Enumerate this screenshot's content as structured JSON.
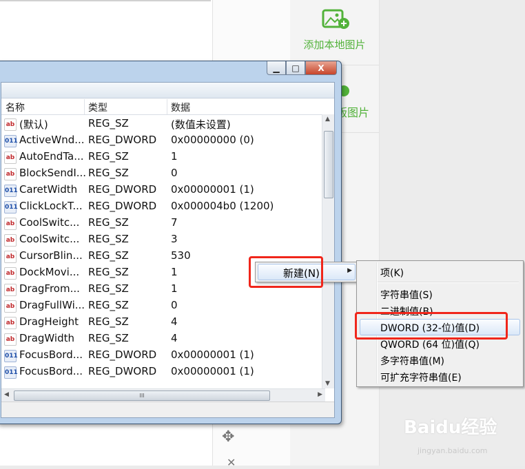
{
  "panel": {
    "add_local_image": "添加本地图片",
    "partial_label": "版图片",
    "watermark": "Baidu经验",
    "watermark_url": "jingyan.baidu.com"
  },
  "window": {
    "min": "▁",
    "max": "□",
    "close": "X"
  },
  "columns": {
    "name": "名称",
    "type": "类型",
    "data": "数据"
  },
  "rows": [
    {
      "icon": "ab",
      "name": "(默认)",
      "type": "REG_SZ",
      "data": "(数值未设置)"
    },
    {
      "icon": "dw",
      "name": "ActiveWnd...",
      "type": "REG_DWORD",
      "data": "0x00000000 (0)"
    },
    {
      "icon": "ab",
      "name": "AutoEndTa...",
      "type": "REG_SZ",
      "data": "1"
    },
    {
      "icon": "ab",
      "name": "BlockSendI...",
      "type": "REG_SZ",
      "data": "0"
    },
    {
      "icon": "dw",
      "name": "CaretWidth",
      "type": "REG_DWORD",
      "data": "0x00000001 (1)"
    },
    {
      "icon": "dw",
      "name": "ClickLockT...",
      "type": "REG_DWORD",
      "data": "0x000004b0 (1200)"
    },
    {
      "icon": "ab",
      "name": "CoolSwitc...",
      "type": "REG_SZ",
      "data": "7"
    },
    {
      "icon": "ab",
      "name": "CoolSwitc...",
      "type": "REG_SZ",
      "data": "3"
    },
    {
      "icon": "ab",
      "name": "CursorBlin...",
      "type": "REG_SZ",
      "data": "530"
    },
    {
      "icon": "ab",
      "name": "DockMovi...",
      "type": "REG_SZ",
      "data": "1"
    },
    {
      "icon": "ab",
      "name": "DragFrom...",
      "type": "REG_SZ",
      "data": "1"
    },
    {
      "icon": "ab",
      "name": "DragFullWi...",
      "type": "REG_SZ",
      "data": "0"
    },
    {
      "icon": "ab",
      "name": "DragHeight",
      "type": "REG_SZ",
      "data": "4"
    },
    {
      "icon": "ab",
      "name": "DragWidth",
      "type": "REG_SZ",
      "data": "4"
    },
    {
      "icon": "dw",
      "name": "FocusBord...",
      "type": "REG_DWORD",
      "data": "0x00000001 (1)"
    },
    {
      "icon": "dw",
      "name": "FocusBord...",
      "type": "REG_DWORD",
      "data": "0x00000001 (1)"
    }
  ],
  "context_menu": {
    "new_label": "新建(N)"
  },
  "submenu": {
    "items": [
      "项(K)",
      "字符串值(S)",
      "二进制值(B)",
      "DWORD (32-位)值(D)",
      "QWORD (64 位)值(Q)",
      "多字符串值(M)",
      "可扩充字符串值(E)"
    ],
    "highlighted": "DWORD (32-位)值(D)"
  },
  "colors": {
    "accent_green": "#52b23a",
    "highlight_red": "#f0261b"
  }
}
